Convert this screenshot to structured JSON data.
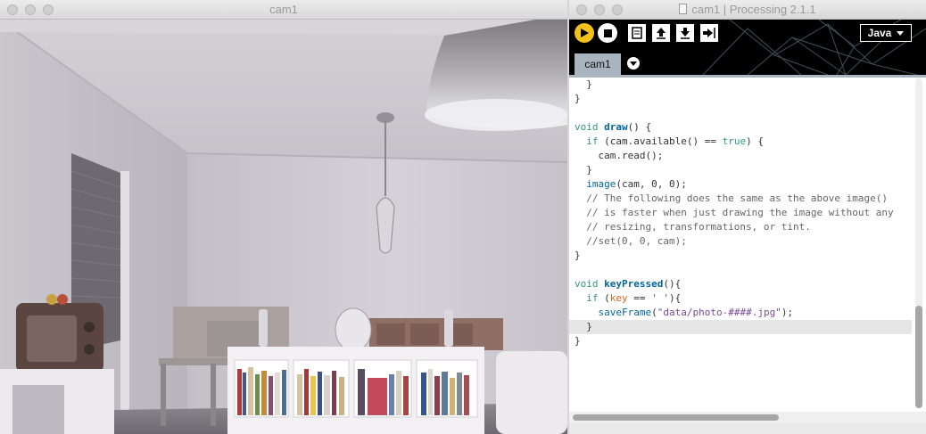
{
  "cam_window": {
    "title": "cam1"
  },
  "ide_window": {
    "title": "cam1 | Processing 2.1.1",
    "toolbar": {
      "mode": "Java",
      "buttons": [
        "run",
        "stop",
        "new",
        "open",
        "save",
        "export"
      ]
    },
    "tab": "cam1",
    "code_lines": [
      [
        [
          "plain",
          "  }"
        ]
      ],
      [
        [
          "plain",
          "}"
        ]
      ],
      [
        [
          "plain",
          ""
        ]
      ],
      [
        [
          "kw",
          "void"
        ],
        [
          "plain",
          " "
        ],
        [
          "fn",
          "draw"
        ],
        [
          "plain",
          "() {"
        ]
      ],
      [
        [
          "plain",
          "  "
        ],
        [
          "kw",
          "if"
        ],
        [
          "plain",
          " (cam.available() == "
        ],
        [
          "lit",
          "true"
        ],
        [
          "plain",
          ") {"
        ]
      ],
      [
        [
          "plain",
          "    cam.read();"
        ]
      ],
      [
        [
          "plain",
          "  }"
        ]
      ],
      [
        [
          "plain",
          "  "
        ],
        [
          "fc",
          "image"
        ],
        [
          "plain",
          "(cam, 0, 0);"
        ]
      ],
      [
        [
          "cm",
          "  // The following does the same as the above image()"
        ]
      ],
      [
        [
          "cm",
          "  // is faster when just drawing the image without any"
        ]
      ],
      [
        [
          "cm",
          "  // resizing, transformations, or tint."
        ]
      ],
      [
        [
          "cm",
          "  //set(0, 0, cam);"
        ]
      ],
      [
        [
          "plain",
          "}"
        ]
      ],
      [
        [
          "plain",
          ""
        ]
      ],
      [
        [
          "kw",
          "void"
        ],
        [
          "plain",
          " "
        ],
        [
          "fn",
          "keyPressed"
        ],
        [
          "plain",
          "(){"
        ]
      ],
      [
        [
          "plain",
          "  "
        ],
        [
          "kw",
          "if"
        ],
        [
          "plain",
          " ("
        ],
        [
          "vr",
          "key"
        ],
        [
          "plain",
          " == "
        ],
        [
          "str",
          "' '"
        ],
        [
          "plain",
          "){"
        ]
      ],
      [
        [
          "plain",
          "    "
        ],
        [
          "fc",
          "saveFrame"
        ],
        [
          "plain",
          "("
        ],
        [
          "str",
          "\"data/photo-####.jpg\""
        ],
        [
          "plain",
          ");"
        ]
      ],
      [
        [
          "plain",
          "  }"
        ]
      ],
      [
        [
          "plain",
          "}"
        ]
      ]
    ],
    "highlighted_line": 17,
    "colors": {
      "toolbar_bg": "#000000",
      "run_button": "#f2c21b",
      "tab_bg": "#a8b4bf",
      "keyword": "#33997e",
      "function": "#006699",
      "string": "#7d4793",
      "comment": "#666666"
    }
  }
}
